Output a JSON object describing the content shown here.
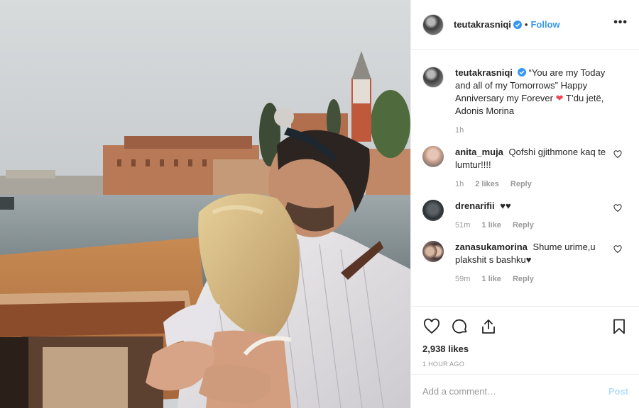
{
  "post": {
    "username": "teutakrasniqi",
    "follow_label": "Follow",
    "dot": "•",
    "more_label": "•••"
  },
  "caption": {
    "username": "teutakrasniqi",
    "text_before_heart": "“You are my Today and all of my Tomorrows” Happy Anniversary my Forever",
    "heart": "❤",
    "text_after_heart": "T’du jetë, Adonis Morina",
    "time": "1h"
  },
  "comments": [
    {
      "username": "anita_muja",
      "text": "Qofshi gjithmone kaq te lumtur!!!!",
      "time": "1h",
      "likes": "2 likes",
      "reply": "Reply"
    },
    {
      "username": "drenarifii",
      "text": "♥♥",
      "time": "51m",
      "likes": "1 like",
      "reply": "Reply"
    },
    {
      "username": "zanasukamorina",
      "text": "Shume urime,u plakshit s bashku♥",
      "time": "59m",
      "likes": "1 like",
      "reply": "Reply"
    }
  ],
  "stats": {
    "likes": "2,938 likes",
    "time_ago": "1 HOUR AGO"
  },
  "add_comment": {
    "placeholder": "Add a comment…",
    "post_label": "Post"
  },
  "icons": {
    "more": "more-options-icon",
    "verified": "verified-badge-icon",
    "like": "heart-icon",
    "comment": "comment-icon",
    "share": "share-icon",
    "save": "bookmark-icon",
    "comment_like": "small-heart-icon"
  },
  "colors": {
    "link_blue": "#3897f0",
    "post_disabled": "#b2dffc",
    "muted": "#999999",
    "heart_red": "#ed4956"
  }
}
